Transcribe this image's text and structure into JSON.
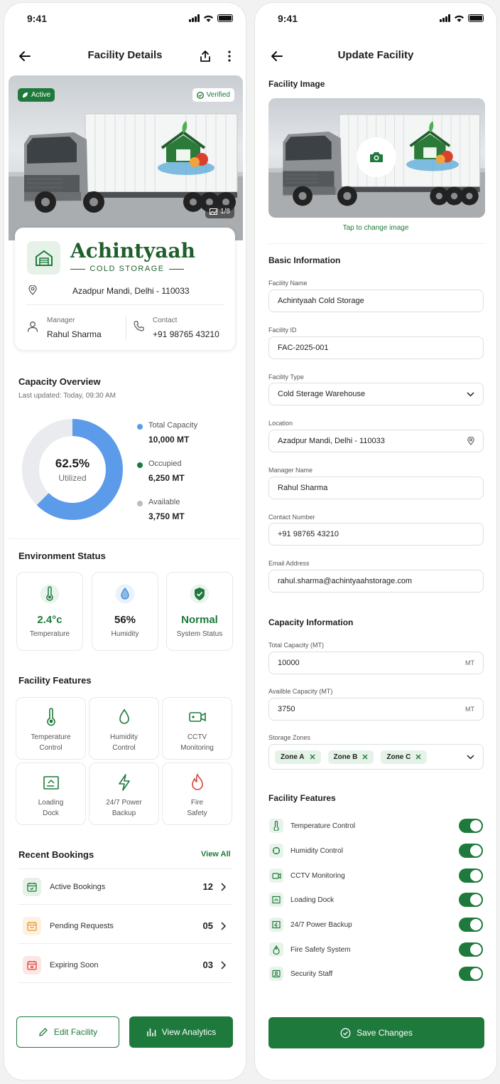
{
  "status": {
    "time": "9:41"
  },
  "details": {
    "title": "Facility Details",
    "badges": {
      "active": "Active",
      "verified": "Verified",
      "counter": "1/8"
    },
    "logo": {
      "brand": "Achintyaah",
      "subtitle": "COLD STORAGE"
    },
    "location": "Azadpur Mandi, Delhi - 110033",
    "manager": {
      "label": "Manager",
      "value": "Rahul Sharma"
    },
    "contact": {
      "label": "Contact",
      "value": "+91 98765 43210"
    },
    "capacity": {
      "title": "Capacity Overview",
      "updated": "Last updated: Today, 09:30 AM",
      "percent": "62.5%",
      "percent_label": "Utilized",
      "utilization": 0.625,
      "legend": [
        {
          "label": "Total Capacity",
          "value": "10,000 MT",
          "color": "#5b9bea"
        },
        {
          "label": "Occupied",
          "value": "6,250 MT",
          "color": "#1e7a3c"
        },
        {
          "label": "Available",
          "value": "3,750 MT",
          "color": "#b9bcc0"
        }
      ]
    },
    "environment": {
      "title": "Environment Status",
      "cards": [
        {
          "value": "2.4°c",
          "label": "Temperature"
        },
        {
          "value": "56%",
          "label": "Humidity"
        },
        {
          "value": "Normal",
          "label": "System Status"
        }
      ]
    },
    "features": {
      "title": "Facility Features",
      "items": [
        {
          "line1": "Temperature",
          "line2": "Control"
        },
        {
          "line1": "Humidity",
          "line2": "Control"
        },
        {
          "line1": "CCTV",
          "line2": "Monitoring"
        },
        {
          "line1": "Loading",
          "line2": "Dock"
        },
        {
          "line1": "24/7 Power",
          "line2": "Backup"
        },
        {
          "line1": "Fire",
          "line2": "Safety"
        }
      ]
    },
    "bookings": {
      "title": "Recent Bookings",
      "view_all": "View All",
      "rows": [
        {
          "label": "Active Bookings",
          "value": "12"
        },
        {
          "label": "Pending Requests",
          "value": "05"
        },
        {
          "label": "Expiring Soon",
          "value": "03"
        }
      ]
    },
    "actions": {
      "edit": "Edit Facility",
      "analytics": "View Analytics"
    }
  },
  "update": {
    "title": "Update Facility",
    "image_section": "Facility Image",
    "change_image": "Tap to change image",
    "basic_title": "Basic Information",
    "fields": {
      "name": {
        "label": "Facility Name",
        "value": "Achintyaah Cold Storage"
      },
      "id": {
        "label": "Facility ID",
        "value": "FAC-2025-001"
      },
      "type": {
        "label": "Facility Type",
        "value": "Cold Sterage Warehouse"
      },
      "location": {
        "label": "Location",
        "value": "Azadpur Mandi, Delhi - 110033"
      },
      "manager": {
        "label": "Manager Name",
        "value": "Rahul Sharma"
      },
      "contact": {
        "label": "Contact Number",
        "value": "+91 98765 43210"
      },
      "email": {
        "label": "Email Address",
        "value": "rahul.sharma@achintyaahstorage.com"
      }
    },
    "capacity_title": "Capacity Information",
    "capacity": {
      "total": {
        "label": "Total Capacity (MT)",
        "value": "10000",
        "unit": "MT"
      },
      "available": {
        "label": "Availble Capacity (MT)",
        "value": "3750",
        "unit": "MT"
      },
      "zones": {
        "label": "Storage Zones",
        "chips": [
          "Zone A",
          "Zone B",
          "Zone C"
        ]
      }
    },
    "features_title": "Facility Features",
    "features": [
      "Temperature Control",
      "Humidity Control",
      "CCTV Monitoring",
      "Loading Dock",
      "24/7 Power Backup",
      "Fire Safety System",
      "Security Staff"
    ],
    "save": "Save Changes"
  }
}
